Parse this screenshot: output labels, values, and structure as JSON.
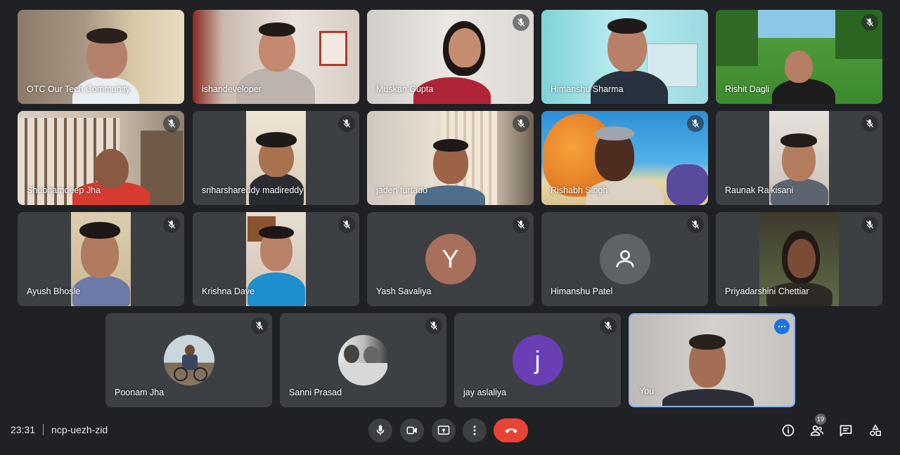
{
  "participants": [
    {
      "name": "OTC Our Tech Community",
      "muted": false
    },
    {
      "name": "ishandeveloper",
      "muted": false
    },
    {
      "name": "Muskan Gupta",
      "muted": true
    },
    {
      "name": "Himanshu Sharma",
      "muted": false
    },
    {
      "name": "Rishit Dagli",
      "muted": true
    },
    {
      "name": "Shubhamdeep Jha",
      "muted": true
    },
    {
      "name": "sriharshareddy madireddy",
      "muted": true
    },
    {
      "name": "jaden furtado",
      "muted": true
    },
    {
      "name": "Rishabh Singh",
      "muted": true
    },
    {
      "name": "Raunak Raikisani",
      "muted": true
    },
    {
      "name": "Ayush Bhosle",
      "muted": true
    },
    {
      "name": "Krishna Dave",
      "muted": true
    },
    {
      "name": "Yash Savaliya",
      "muted": true,
      "initial": "Y",
      "avatar_color": "#a86f5c"
    },
    {
      "name": "Himanshu Patel",
      "muted": true,
      "avatar_color": "#5f6368"
    },
    {
      "name": "Priyadarshini Chettiar",
      "muted": true
    },
    {
      "name": "Poonam Jha",
      "muted": true
    },
    {
      "name": "Sanni Prasad",
      "muted": true
    },
    {
      "name": "jay aslaliya",
      "muted": true,
      "initial": "j",
      "avatar_color": "#6a3fb5"
    },
    {
      "name": "You",
      "muted": false
    }
  ],
  "meeting": {
    "time": "23:31",
    "code": "ncp-uezh-zid"
  },
  "controls": {
    "mic": "mic-icon",
    "camera": "camera-icon",
    "present": "present-screen-icon",
    "more": "more-options-icon",
    "end": "end-call-icon"
  },
  "right_panel": {
    "info": "info-icon",
    "people": "people-icon",
    "people_count": "19",
    "chat": "chat-icon",
    "activities": "activities-icon"
  },
  "colors": {
    "background": "#202124",
    "tile": "#3c4043",
    "end_call": "#ea4335",
    "self_border": "#8ab4f8"
  }
}
